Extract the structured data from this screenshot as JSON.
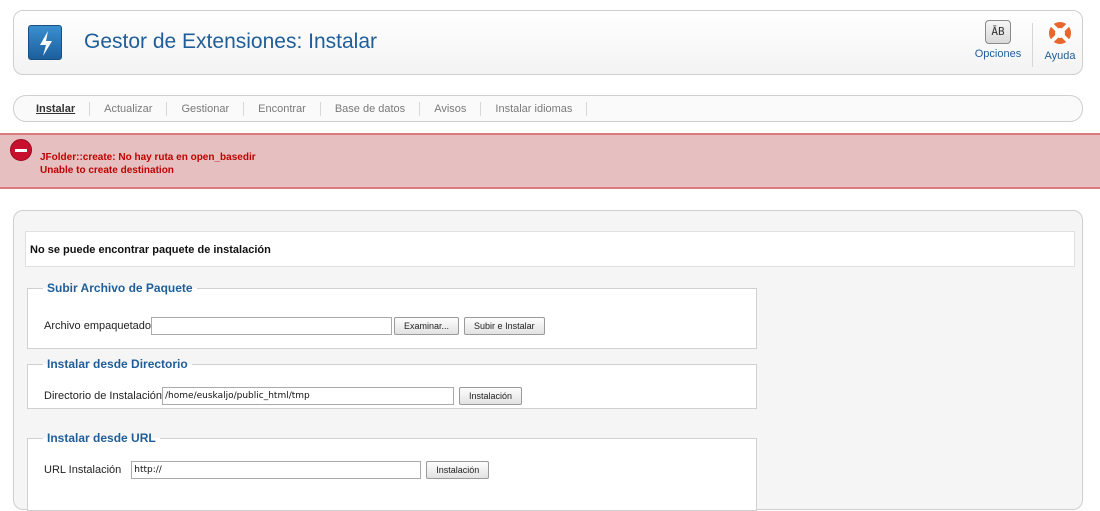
{
  "header": {
    "title": "Gestor de Extensiones: Instalar",
    "logo_icon": "lightning-icon",
    "toolbar": {
      "options_label": "Opciones",
      "options_icon": "options-icon",
      "help_label": "Ayuda",
      "help_icon": "lifebuoy-icon"
    }
  },
  "tabs": [
    {
      "label": "Instalar",
      "active": true
    },
    {
      "label": "Actualizar",
      "active": false
    },
    {
      "label": "Gestionar",
      "active": false
    },
    {
      "label": "Encontrar",
      "active": false
    },
    {
      "label": "Base de datos",
      "active": false
    },
    {
      "label": "Avisos",
      "active": false
    },
    {
      "label": "Instalar idiomas",
      "active": false
    }
  ],
  "error": {
    "line1": "JFolder::create: No hay ruta en open_basedir",
    "line2": "Unable to create destination",
    "icon": "stop-icon",
    "color": "#c00000"
  },
  "main": {
    "notice": "No se puede encontrar paquete de instalación",
    "upload": {
      "legend": "Subir Archivo de Paquete",
      "label": "Archivo empaquetado",
      "file_value": "",
      "browse_label": "Examinar...",
      "submit_label": "Subir e Instalar"
    },
    "directory": {
      "legend": "Instalar desde Directorio",
      "label": "Directorio de Instalación",
      "value": "/home/euskaljo/public_html/tmp",
      "button_label": "Instalación"
    },
    "url": {
      "legend": "Instalar desde URL",
      "label": "URL Instalación",
      "value": "http://",
      "button_label": "Instalación"
    }
  },
  "colors": {
    "accent": "#1f5e98",
    "error_bg": "#e6c0c0",
    "error_border": "#de7a7b"
  }
}
